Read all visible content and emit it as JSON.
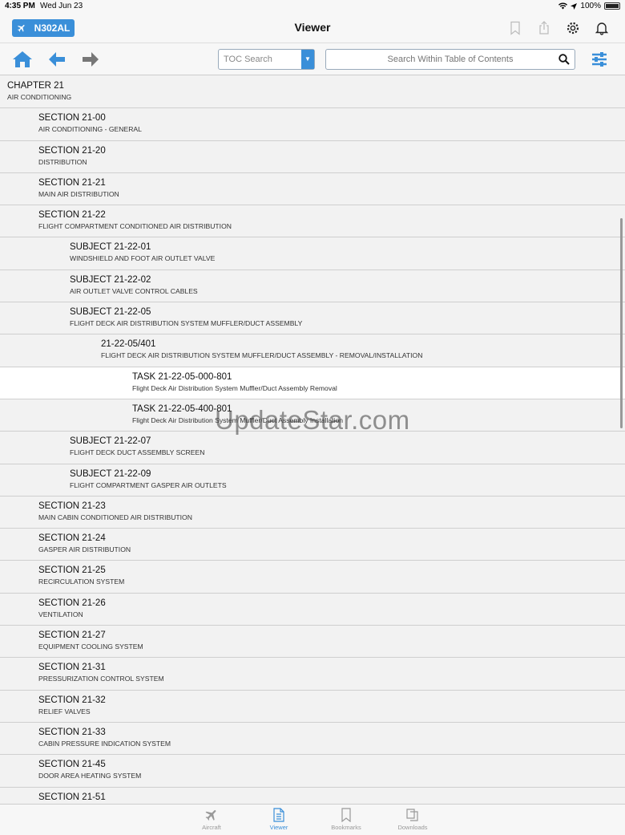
{
  "status": {
    "time": "4:35 PM",
    "date": "Wed Jun 23",
    "battery": "100%"
  },
  "nav": {
    "tail": "N302AL",
    "title": "Viewer"
  },
  "toolbar": {
    "toc_select": "TOC Search",
    "search_placeholder": "Search Within Table of Contents"
  },
  "rows": [
    {
      "level": 0,
      "title": "CHAPTER 21",
      "sub": "AIR CONDITIONING"
    },
    {
      "level": 1,
      "title": "SECTION 21-00",
      "sub": "AIR CONDITIONING - GENERAL"
    },
    {
      "level": 1,
      "title": "SECTION 21-20",
      "sub": "DISTRIBUTION"
    },
    {
      "level": 1,
      "title": "SECTION 21-21",
      "sub": "MAIN AIR DISTRIBUTION"
    },
    {
      "level": 1,
      "title": "SECTION 21-22",
      "sub": "FLIGHT COMPARTMENT CONDITIONED AIR DISTRIBUTION"
    },
    {
      "level": 2,
      "title": "SUBJECT 21-22-01",
      "sub": "WINDSHIELD AND FOOT AIR OUTLET VALVE"
    },
    {
      "level": 2,
      "title": "SUBJECT 21-22-02",
      "sub": "AIR OUTLET VALVE CONTROL CABLES"
    },
    {
      "level": 2,
      "title": "SUBJECT 21-22-05",
      "sub": "FLIGHT DECK AIR DISTRIBUTION SYSTEM MUFFLER/DUCT ASSEMBLY"
    },
    {
      "level": 3,
      "title": "21-22-05/401",
      "sub": "FLIGHT DECK AIR DISTRIBUTION SYSTEM MUFFLER/DUCT ASSEMBLY - REMOVAL/INSTALLATION"
    },
    {
      "level": 4,
      "title": "TASK 21-22-05-000-801",
      "sub": "Flight Deck Air Distribution System Muffler/Duct Assembly Removal",
      "selected": true
    },
    {
      "level": 4,
      "title": "TASK 21-22-05-400-801",
      "sub": "Flight Deck Air Distribution System Muffler/Duct Assembly Installation"
    },
    {
      "level": 2,
      "title": "SUBJECT 21-22-07",
      "sub": "FLIGHT DECK DUCT ASSEMBLY SCREEN"
    },
    {
      "level": 2,
      "title": "SUBJECT 21-22-09",
      "sub": "FLIGHT COMPARTMENT GASPER AIR OUTLETS"
    },
    {
      "level": 1,
      "title": "SECTION 21-23",
      "sub": "MAIN CABIN CONDITIONED AIR DISTRIBUTION"
    },
    {
      "level": 1,
      "title": "SECTION 21-24",
      "sub": "GASPER AIR DISTRIBUTION"
    },
    {
      "level": 1,
      "title": "SECTION 21-25",
      "sub": "RECIRCULATION SYSTEM"
    },
    {
      "level": 1,
      "title": "SECTION 21-26",
      "sub": "VENTILATION"
    },
    {
      "level": 1,
      "title": "SECTION 21-27",
      "sub": "EQUIPMENT COOLING SYSTEM"
    },
    {
      "level": 1,
      "title": "SECTION 21-31",
      "sub": "PRESSURIZATION CONTROL SYSTEM"
    },
    {
      "level": 1,
      "title": "SECTION 21-32",
      "sub": "RELIEF VALVES"
    },
    {
      "level": 1,
      "title": "SECTION 21-33",
      "sub": "CABIN PRESSURE INDICATION SYSTEM"
    },
    {
      "level": 1,
      "title": "SECTION 21-45",
      "sub": "DOOR AREA HEATING SYSTEM"
    },
    {
      "level": 1,
      "title": "SECTION 21-51",
      "sub": ""
    }
  ],
  "watermark": "UpdateStar.com",
  "tabs": [
    {
      "label": "Aircraft",
      "icon": "airplane-icon",
      "active": false
    },
    {
      "label": "Viewer",
      "icon": "document-icon",
      "active": true
    },
    {
      "label": "Bookmarks",
      "icon": "bookmarks-icon",
      "active": false
    },
    {
      "label": "Downloads",
      "icon": "downloads-icon",
      "active": false
    }
  ],
  "colors": {
    "accent": "#3a8fd9",
    "selected_row": "#ffffff",
    "row_bg": "#f2f2f2"
  }
}
